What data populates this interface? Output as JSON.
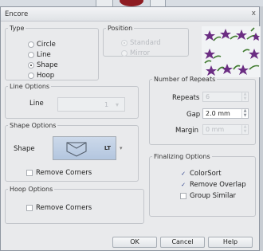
{
  "dialog": {
    "title": "Encore",
    "close_glyph": "x"
  },
  "type_group": {
    "legend": "Type",
    "options": [
      {
        "label": "Circle",
        "selected": false
      },
      {
        "label": "Line",
        "selected": false
      },
      {
        "label": "Shape",
        "selected": true
      },
      {
        "label": "Hoop",
        "selected": false
      }
    ]
  },
  "position_group": {
    "legend": "Position",
    "options": [
      {
        "label": "Standard",
        "selected": true,
        "disabled": true
      },
      {
        "label": "Mirror",
        "selected": false,
        "disabled": true
      }
    ]
  },
  "line_options": {
    "legend": "Line Options",
    "line_label": "Line",
    "line_value": "1"
  },
  "repeats": {
    "legend": "Number of Repeats",
    "repeats_label": "Repeats",
    "repeats_value": "6",
    "gap_label": "Gap",
    "gap_value": "2.0 mm",
    "margin_label": "Margin",
    "margin_value": "0 mm"
  },
  "shape_options": {
    "legend": "Shape Options",
    "shape_label": "Shape",
    "shape_code": "LT",
    "remove_corners": "Remove Corners"
  },
  "hoop_options": {
    "legend": "Hoop Options",
    "remove_corners": "Remove Corners"
  },
  "finalizing": {
    "legend": "Finalizing Options",
    "colorsort": {
      "label": "ColorSort",
      "checked": true
    },
    "remove_overlap": {
      "label": "Remove Overlap",
      "checked": true
    },
    "group_similar": {
      "label": "Group Similar",
      "checked": false
    }
  },
  "buttons": {
    "ok": "OK",
    "cancel": "Cancel",
    "help": "Help"
  },
  "colors": {
    "accent_purple": "#6b2d83",
    "leaf_green": "#3f7a2e",
    "preview_blue": "#c3d3e8"
  }
}
